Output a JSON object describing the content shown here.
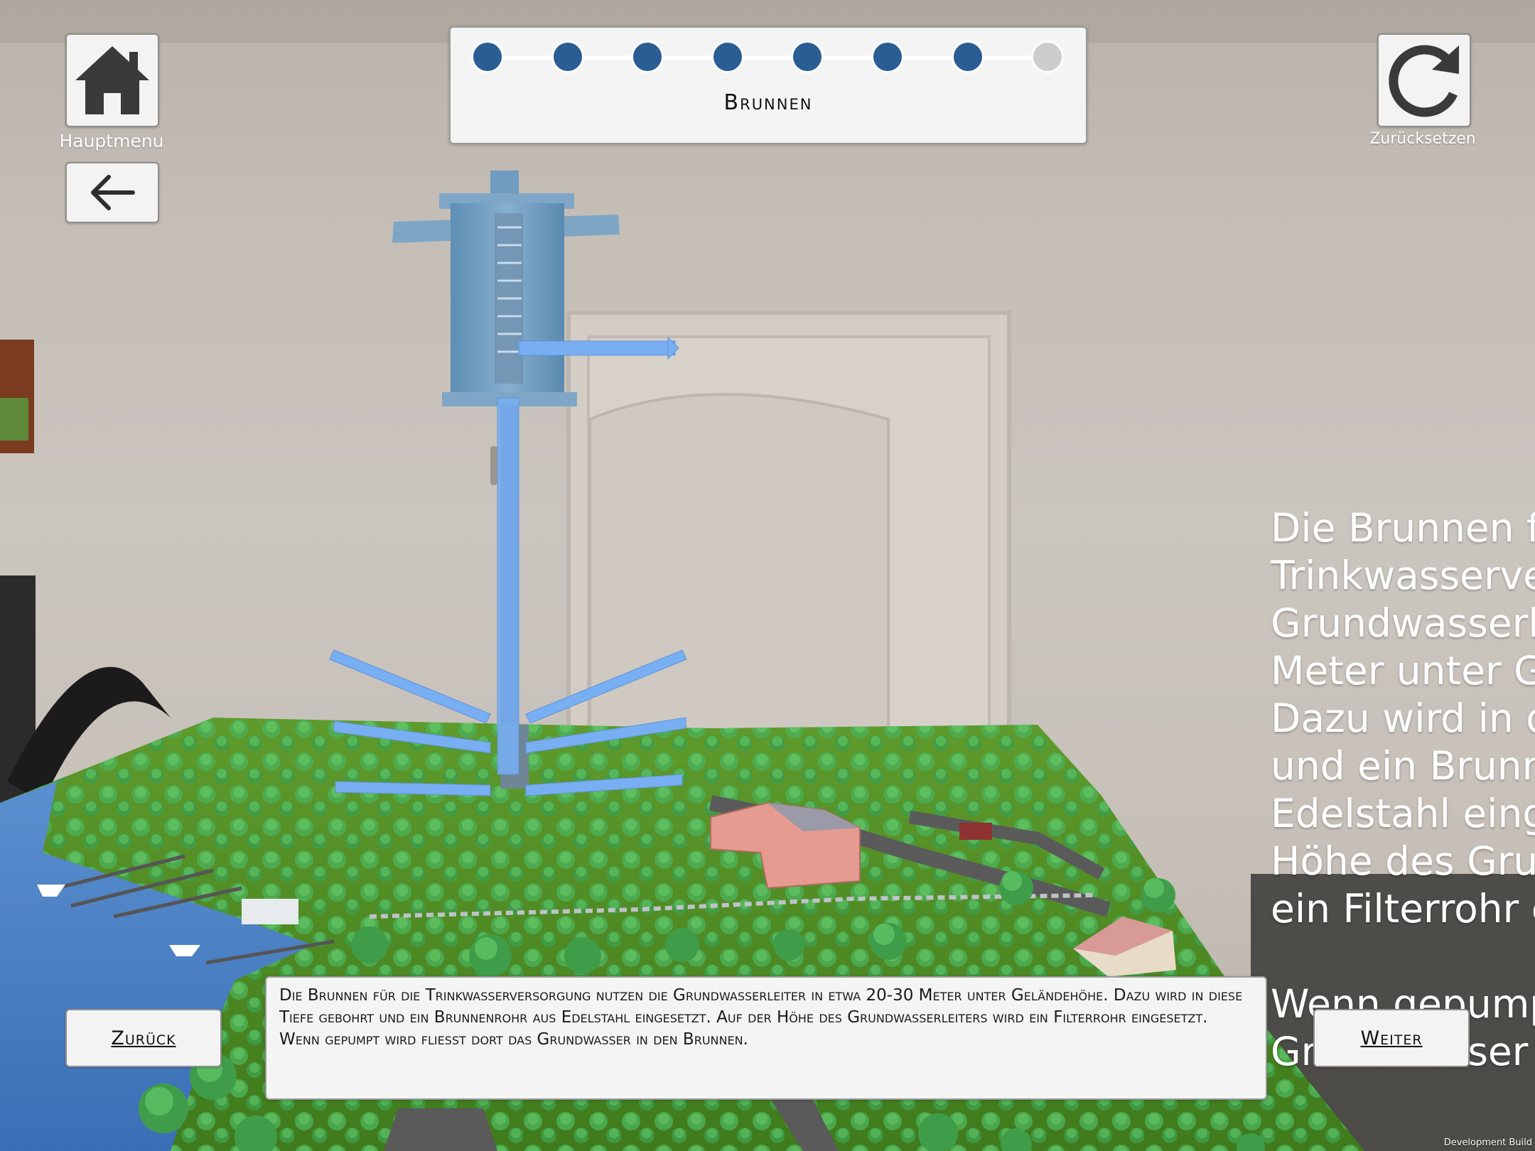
{
  "topbar": {
    "home_label": "Hauptmenu",
    "reset_label": "Zurücksetzen"
  },
  "progress": {
    "title": "Brunnen",
    "total_steps": 8,
    "completed_steps": 7,
    "active_color": "#2a5d94",
    "inactive_color": "#cdcdcd"
  },
  "description": {
    "text": "Die Brunnen für die Trinkwasserversorgung nutzen die Grundwasserleiter in etwa 20-30 Meter unter Geländehöhe. Dazu wird in diese Tiefe gebohrt und ein Brunnenrohr aus Edelstahl eingesetzt. Auf der Höhe des Grundwasserleiters wird ein Filterrohr eingesetzt. Wenn gepumpt wird fließt dort das Grundwasser in den Brunnen."
  },
  "navigation": {
    "back_label": "Zurück",
    "next_label": "Weiter"
  },
  "world_text": {
    "lines": [
      "Die Brunnen f",
      "Trinkwasserve",
      "Grundwasserl",
      "Meter unter G",
      "Dazu wird in d",
      "und ein Brunn",
      "Edelstahl eing",
      "Höhe des Gru",
      "ein Filterrohr e",
      "",
      "Wenn gepump",
      "Grundwasser i"
    ]
  },
  "footer": {
    "build_label": "Development Build"
  },
  "icons": {
    "home": "home-icon",
    "back": "arrow-left-icon",
    "reset": "refresh-icon"
  }
}
